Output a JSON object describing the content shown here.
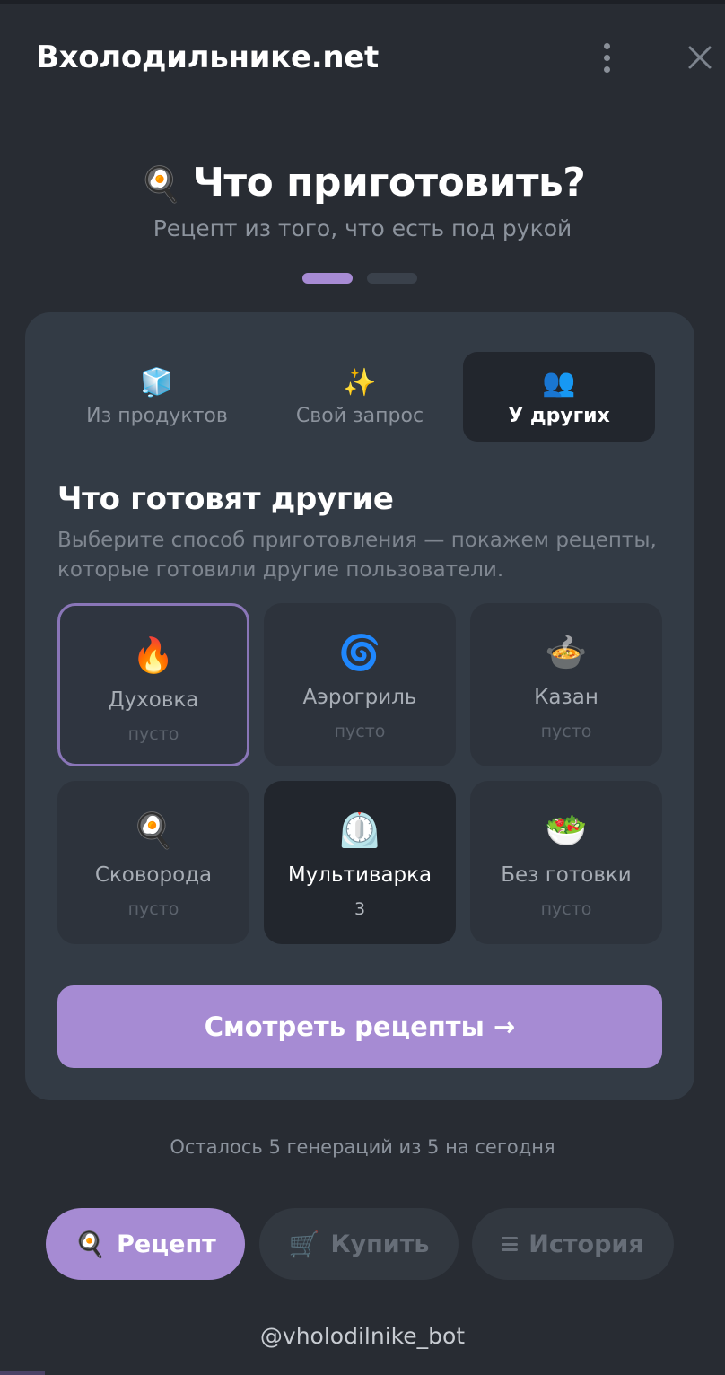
{
  "header": {
    "app_title": "Вхолодильнике.net",
    "menu_icon": "kebab-menu-icon",
    "close_icon": "close-icon"
  },
  "hero": {
    "emoji": "🍳",
    "title": "Что приготовить?",
    "subtitle": "Рецепт из того, что есть под рукой"
  },
  "pager": {
    "count": 2,
    "active_index": 0
  },
  "tabs": [
    {
      "icon": "🧊",
      "label": "Из продуктов",
      "active": false
    },
    {
      "icon": "✨",
      "label": "Свой запрос",
      "active": false
    },
    {
      "icon": "👥",
      "label": "У других",
      "active": true
    }
  ],
  "section": {
    "title": "Что готовят другие",
    "description": "Выберите способ приготовления — покажем рецепты, которые готовили другие пользователи."
  },
  "methods": [
    {
      "icon": "🔥",
      "name": "Духовка",
      "count": "пусто",
      "state": "selected"
    },
    {
      "icon": "🌀",
      "name": "Аэрогриль",
      "count": "пусто",
      "state": "empty"
    },
    {
      "icon": "🍲",
      "name": "Казан",
      "count": "пусто",
      "state": "empty"
    },
    {
      "icon": "🍳",
      "name": "Сковорода",
      "count": "пусто",
      "state": "empty"
    },
    {
      "icon": "⏲️",
      "name": "Мультиварка",
      "count": "3",
      "state": "filled"
    },
    {
      "icon": "🥗",
      "name": "Без готовки",
      "count": "пусто",
      "state": "empty"
    }
  ],
  "cta": {
    "label": "Смотреть рецепты →"
  },
  "quota": {
    "text": "Осталось 5 генераций из 5 на сегодня"
  },
  "bottom_nav": {
    "recipe": {
      "icon": "🍳",
      "label": "Рецепт",
      "active": true
    },
    "buy": {
      "icon": "🛒",
      "label": "Купить",
      "active": false
    },
    "history": {
      "icon": "hamburger-icon",
      "label": "История",
      "active": false
    }
  },
  "bot_handle": "@vholodilnike_bot",
  "colors": {
    "background": "#282c33",
    "card": "#333b45",
    "accent": "#a68bd3",
    "selected_border": "#8a76b8",
    "muted_text": "#8c939d"
  }
}
